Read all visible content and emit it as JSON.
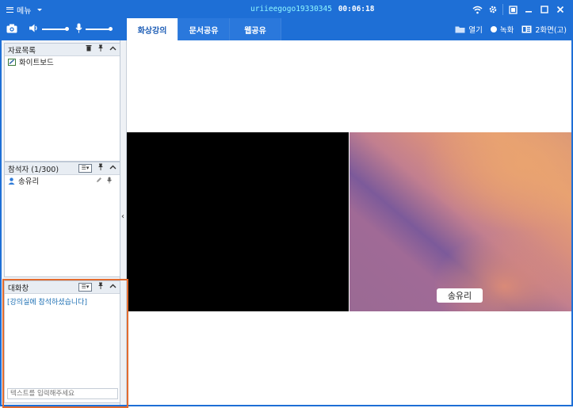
{
  "titlebar": {
    "menu_label": "메뉴",
    "user": "uriieegogo19330345",
    "time": "00:06:18"
  },
  "tabs": [
    {
      "label": "화상강의",
      "active": true
    },
    {
      "label": "문서공유",
      "active": false
    },
    {
      "label": "웹공유",
      "active": false
    }
  ],
  "right_tools": {
    "open_label": "열기",
    "record_label": "녹화",
    "screens_label": "2화면(고)"
  },
  "materials": {
    "title": "자료목록",
    "items": [
      "화이트보드"
    ]
  },
  "participants": {
    "title": "참석자 (1/300)",
    "items": [
      "송유리"
    ]
  },
  "chat": {
    "title": "대화창",
    "messages": [
      "[강의실에 참석하셨습니다]"
    ],
    "input_placeholder": "텍스트를 입력해주세요"
  },
  "video": {
    "name_tag": "송유리"
  },
  "colors": {
    "brand": "#1e6fd6",
    "highlight": "#e36b2f",
    "chat_text": "#1b6eb3"
  }
}
